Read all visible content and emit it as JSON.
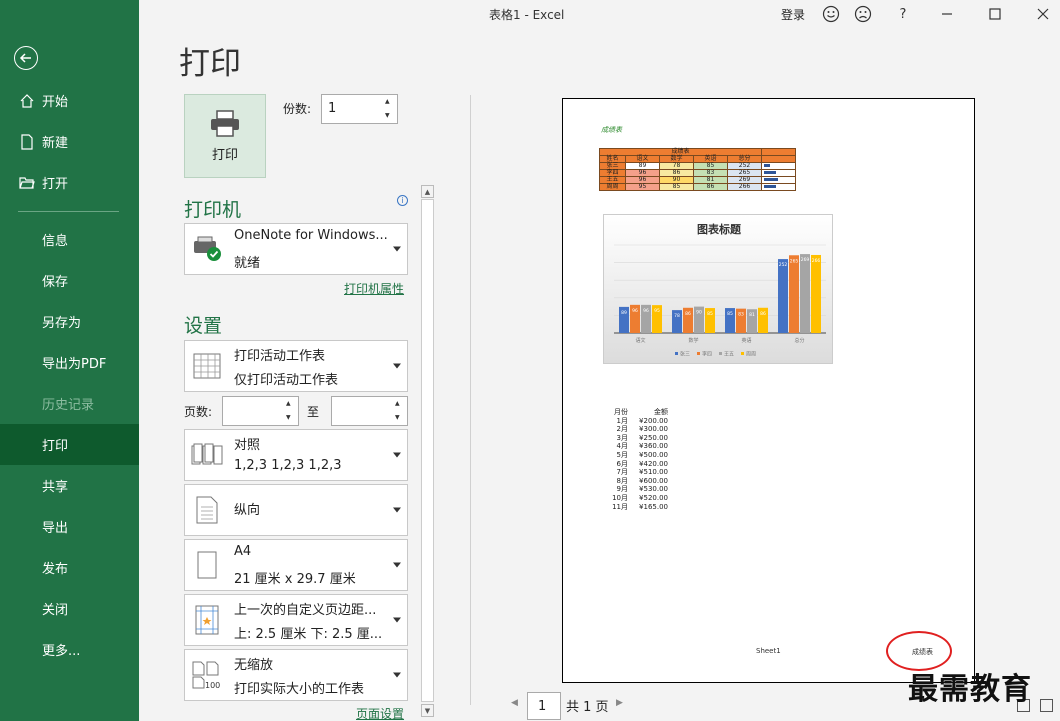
{
  "window": {
    "title": "表格1  -  Excel",
    "login": "登录",
    "help": "?"
  },
  "sidebar": {
    "items": [
      {
        "label": "开始",
        "icon": "home-icon"
      },
      {
        "label": "新建",
        "icon": "new-file-icon"
      },
      {
        "label": "打开",
        "icon": "folder-open-icon"
      },
      {
        "label": "信息"
      },
      {
        "label": "保存"
      },
      {
        "label": "另存为"
      },
      {
        "label": "导出为PDF"
      },
      {
        "label": "历史记录",
        "disabled": true
      },
      {
        "label": "打印",
        "active": true
      },
      {
        "label": "共享"
      },
      {
        "label": "导出"
      },
      {
        "label": "发布"
      },
      {
        "label": "关闭"
      },
      {
        "label": "更多..."
      }
    ]
  },
  "page": {
    "title": "打印"
  },
  "print": {
    "button_label": "打印",
    "copies_label": "份数:",
    "copies_value": "1"
  },
  "printer": {
    "section_title": "打印机",
    "name": "OneNote for Windows...",
    "status": "就绪",
    "properties_link": "打印机属性"
  },
  "settings": {
    "section_title": "设置",
    "scope": {
      "line1": "打印活动工作表",
      "line2": "仅打印活动工作表"
    },
    "pages_label": "页数:",
    "to_label": "至",
    "collate": {
      "line1": "对照",
      "line2": "1,2,3     1,2,3     1,2,3"
    },
    "orientation": {
      "line1": "纵向"
    },
    "paper": {
      "line1": "A4",
      "line2": "21 厘米 x 29.7 厘米"
    },
    "margins": {
      "line1": "上一次的自定义页边距...",
      "line2": "上: 2.5 厘米 下: 2.5 厘..."
    },
    "scaling": {
      "line1": "无缩放",
      "line2": "打印实际大小的工作表",
      "icon_text": "100"
    },
    "page_setup_link": "页面设置"
  },
  "preview": {
    "header_note": "成绩表",
    "table": {
      "title": "成绩表",
      "headers": [
        "姓名",
        "语文",
        "数学",
        "英语",
        "总分"
      ],
      "rows": [
        [
          "张三",
          "89",
          "78",
          "85",
          "252"
        ],
        [
          "李四",
          "96",
          "86",
          "83",
          "265"
        ],
        [
          "王五",
          "96",
          "90",
          "81",
          "269"
        ],
        [
          "周周",
          "95",
          "85",
          "86",
          "266"
        ]
      ]
    },
    "months": {
      "headers": [
        "月份",
        "金额"
      ],
      "rows": [
        [
          "1月",
          "¥200.00"
        ],
        [
          "2月",
          "¥300.00"
        ],
        [
          "3月",
          "¥250.00"
        ],
        [
          "4月",
          "¥360.00"
        ],
        [
          "5月",
          "¥500.00"
        ],
        [
          "6月",
          "¥420.00"
        ],
        [
          "7月",
          "¥510.00"
        ],
        [
          "8月",
          "¥600.00"
        ],
        [
          "9月",
          "¥530.00"
        ],
        [
          "10月",
          "¥520.00"
        ],
        [
          "11月",
          "¥165.00"
        ]
      ]
    },
    "footer_sheet": "Sheet1",
    "footer_name": "成绩表"
  },
  "pager": {
    "current": "1",
    "total_label": "共 1 页"
  },
  "watermark": "最需教育",
  "colors": {
    "accent": "#217346",
    "accent_dark": "#0e5a2d",
    "series": [
      "#4472c4",
      "#ed7d31",
      "#a5a5a5",
      "#ffc000"
    ]
  },
  "chart_data": {
    "type": "bar",
    "title": "图表标题",
    "categories": [
      "语文",
      "数学",
      "英语",
      "总分"
    ],
    "series": [
      {
        "name": "张三",
        "values": [
          89,
          78,
          85,
          252
        ]
      },
      {
        "name": "李四",
        "values": [
          96,
          86,
          83,
          265
        ]
      },
      {
        "name": "王五",
        "values": [
          96,
          90,
          81,
          269
        ]
      },
      {
        "name": "周周",
        "values": [
          95,
          85,
          86,
          266
        ]
      }
    ],
    "ylim": [
      0,
      300
    ],
    "grid": true,
    "legend": "bottom"
  }
}
